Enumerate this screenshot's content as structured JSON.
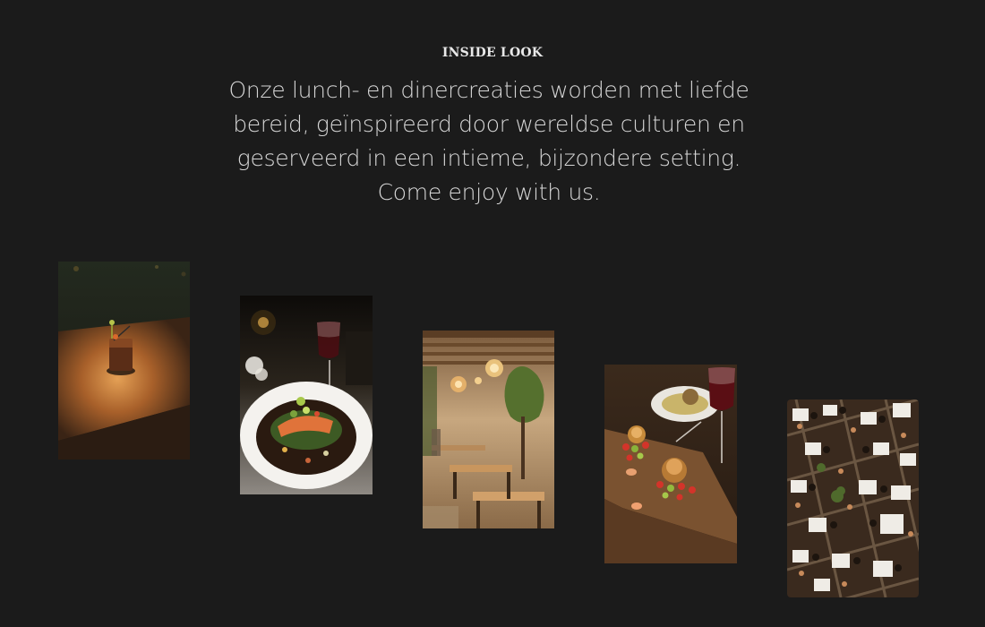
{
  "section": {
    "eyebrow": "INSIDE LOOK",
    "intro_lines": [
      "Onze lunch- en dinercreaties worden met liefde",
      "bereid, geïnspireerd door wereldse culturen en",
      "geserveerd in een intieme, bijzondere setting.",
      "Come enjoy with us."
    ]
  },
  "gallery": {
    "photos": [
      {
        "subject": "cocktail glass on sunlit wooden table"
      },
      {
        "subject": "plated salmon dish with red wine"
      },
      {
        "subject": "restaurant interior with pendant lamps"
      },
      {
        "subject": "food boards with burgers and red wine"
      },
      {
        "subject": "overhead view of busy dining room"
      }
    ]
  },
  "colors": {
    "background": "#1b1b1b",
    "heading_text": "#e9e9e9",
    "body_text": "#d6d6d6"
  }
}
